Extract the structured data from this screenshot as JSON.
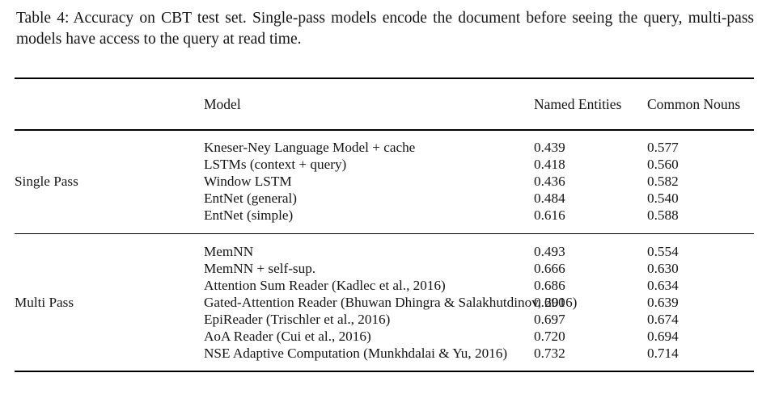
{
  "caption": {
    "label": "Table 4:",
    "text": "Accuracy on CBT test set.  Single-pass models encode the document before seeing the query, multi-pass models have access to the query at read time."
  },
  "table": {
    "columns": {
      "group": "",
      "model": "Model",
      "named_entities": "Named Entities",
      "common_nouns": "Common Nouns"
    },
    "sections": [
      {
        "group_label": "Single Pass",
        "rows": [
          {
            "model": "Kneser-Ney Language Model + cache",
            "named_entities": "0.439",
            "common_nouns": "0.577",
            "bold": false
          },
          {
            "model": "LSTMs (context + query)",
            "named_entities": "0.418",
            "common_nouns": "0.560",
            "bold": false
          },
          {
            "model": "Window LSTM",
            "named_entities": "0.436",
            "common_nouns": "0.582",
            "bold": false
          },
          {
            "model": "EntNet (general)",
            "named_entities": "0.484",
            "common_nouns": "0.540",
            "bold": false
          },
          {
            "model": "EntNet (simple)",
            "named_entities": "0.616",
            "common_nouns": "0.588",
            "bold": true
          }
        ]
      },
      {
        "group_label": "Multi Pass",
        "rows": [
          {
            "model": "MemNN",
            "named_entities": "0.493",
            "common_nouns": "0.554",
            "bold": false
          },
          {
            "model": "MemNN + self-sup.",
            "named_entities": "0.666",
            "common_nouns": "0.630",
            "bold": false
          },
          {
            "model": "Attention Sum Reader (Kadlec et al., 2016)",
            "named_entities": "0.686",
            "common_nouns": "0.634",
            "bold": false
          },
          {
            "model": "Gated-Attention Reader (Bhuwan Dhingra & Salakhutdinov, 2016)",
            "named_entities": "0.690",
            "common_nouns": "0.639",
            "bold": false
          },
          {
            "model": "EpiReader (Trischler et al., 2016)",
            "named_entities": "0.697",
            "common_nouns": "0.674",
            "bold": false
          },
          {
            "model": "AoA Reader (Cui et al., 2016)",
            "named_entities": "0.720",
            "common_nouns": "0.694",
            "bold": false
          },
          {
            "model": "NSE Adaptive Computation (Munkhdalai & Yu, 2016)",
            "named_entities": "0.732",
            "common_nouns": "0.714",
            "bold": true
          }
        ]
      }
    ]
  },
  "colors": {
    "text": "#141414",
    "rule": "#000000",
    "background": "#ffffff"
  }
}
